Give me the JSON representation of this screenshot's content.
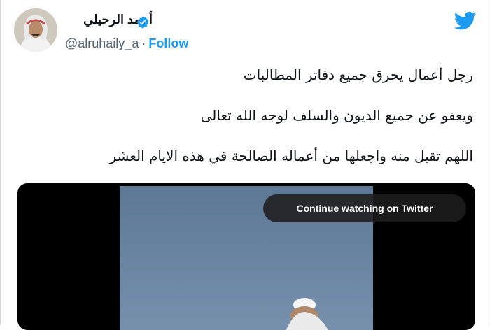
{
  "author": {
    "name": "أحمد الرحيلي",
    "handle": "@alruhaily_a",
    "separator": "·",
    "follow_label": "Follow",
    "verified_icon": "verified-badge-icon"
  },
  "brand": {
    "icon": "twitter-bird-icon",
    "color": "#1d9bf0"
  },
  "tweet": {
    "lines": [
      "رجل أعمال يحرق جميع دفاتر المطالبات",
      "ويعفو عن جميع الديون والسلف لوجه الله تعالى",
      "اللهم تقبل منه واجعلها من أعماله الصالحة في هذه الايام العشر"
    ]
  },
  "video": {
    "cta_label": "Continue watching on Twitter"
  }
}
